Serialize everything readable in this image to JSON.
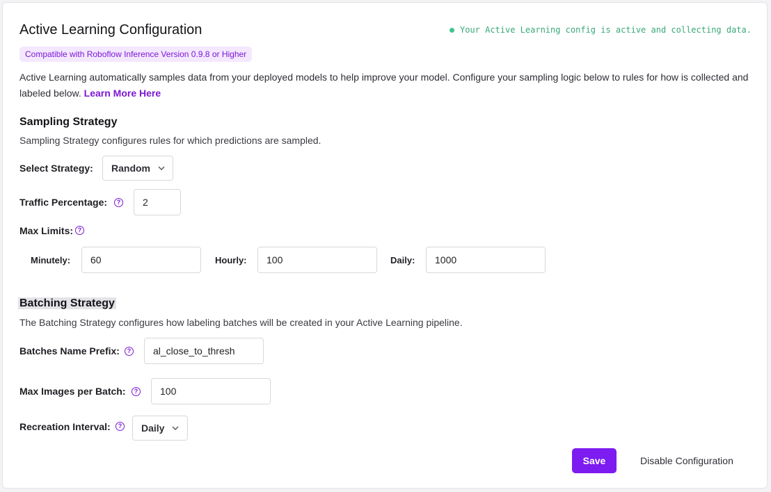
{
  "header": {
    "title": "Active Learning Configuration",
    "status_text": "Your Active Learning config is active and collecting data.",
    "compat_badge": "Compatible with Roboflow Inference Version 0.9.8 or Higher",
    "description": "Active Learning automatically samples data from your deployed models to help improve your model. Configure your sampling logic below to rules for how is collected and labeled below.",
    "learn_more": "Learn More Here"
  },
  "sampling": {
    "heading": "Sampling Strategy",
    "subheading": "Sampling Strategy configures rules for which predictions are sampled.",
    "strategy_label": "Select Strategy:",
    "strategy_value": "Random",
    "traffic_label": "Traffic Percentage:",
    "traffic_value": "2",
    "max_limits_label": "Max Limits:",
    "minutely_label": "Minutely:",
    "minutely_value": "60",
    "hourly_label": "Hourly:",
    "hourly_value": "100",
    "daily_label": "Daily:",
    "daily_value": "1000"
  },
  "batching": {
    "heading": "Batching Strategy",
    "subheading": "The Batching Strategy configures how labeling batches will be created in your Active Learning pipeline.",
    "prefix_label": "Batches Name Prefix:",
    "prefix_value": "al_close_to_thresh",
    "max_images_label": "Max Images per Batch:",
    "max_images_value": "100",
    "recreation_label": "Recreation Interval:",
    "recreation_value": "Daily"
  },
  "actions": {
    "save_label": "Save",
    "disable_label": "Disable Configuration"
  },
  "icons": {
    "help": "help-circle-icon",
    "chevron": "chevron-down-icon",
    "status": "status-dot-icon"
  },
  "colors": {
    "accent": "#7c1cf0",
    "status_green": "#3aa87a",
    "badge_bg": "#f4e8ff"
  }
}
